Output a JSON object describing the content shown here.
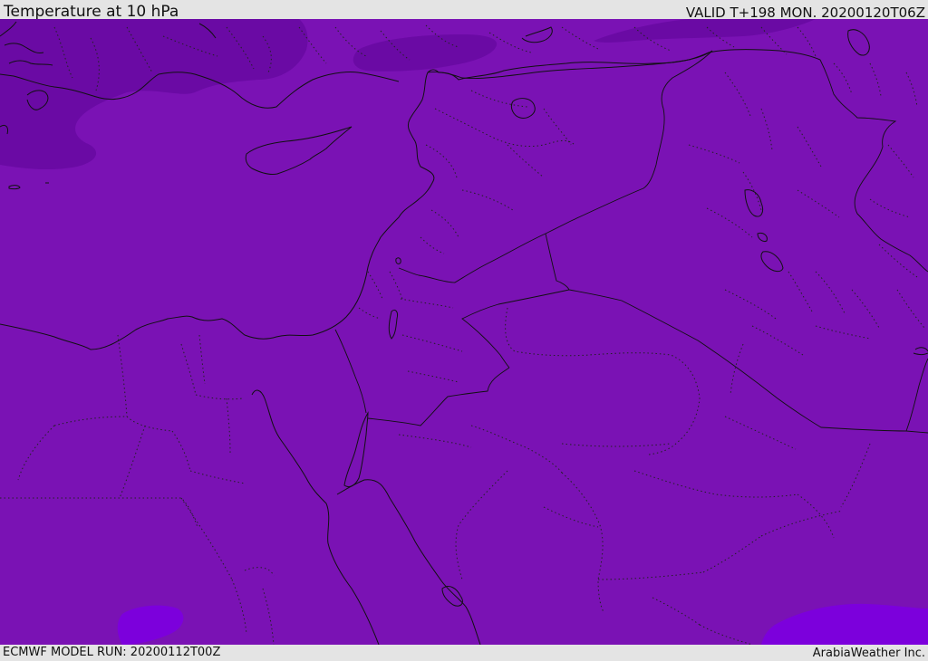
{
  "header": {
    "title": "Temperature at 10 hPa",
    "valid": "VALID T+198 MON. 20200120T06Z"
  },
  "footer": {
    "model_run": "ECMWF MODEL RUN: 20200112T00Z",
    "credit": "ArabiaWeather Inc."
  },
  "map": {
    "field": "temperature",
    "level": "10 hPa",
    "colors": {
      "base_field": "#7a12b4",
      "cold_field": "#6a0aa4",
      "warm_field": "#7c00dc",
      "boundary_lines": "#111111"
    }
  }
}
